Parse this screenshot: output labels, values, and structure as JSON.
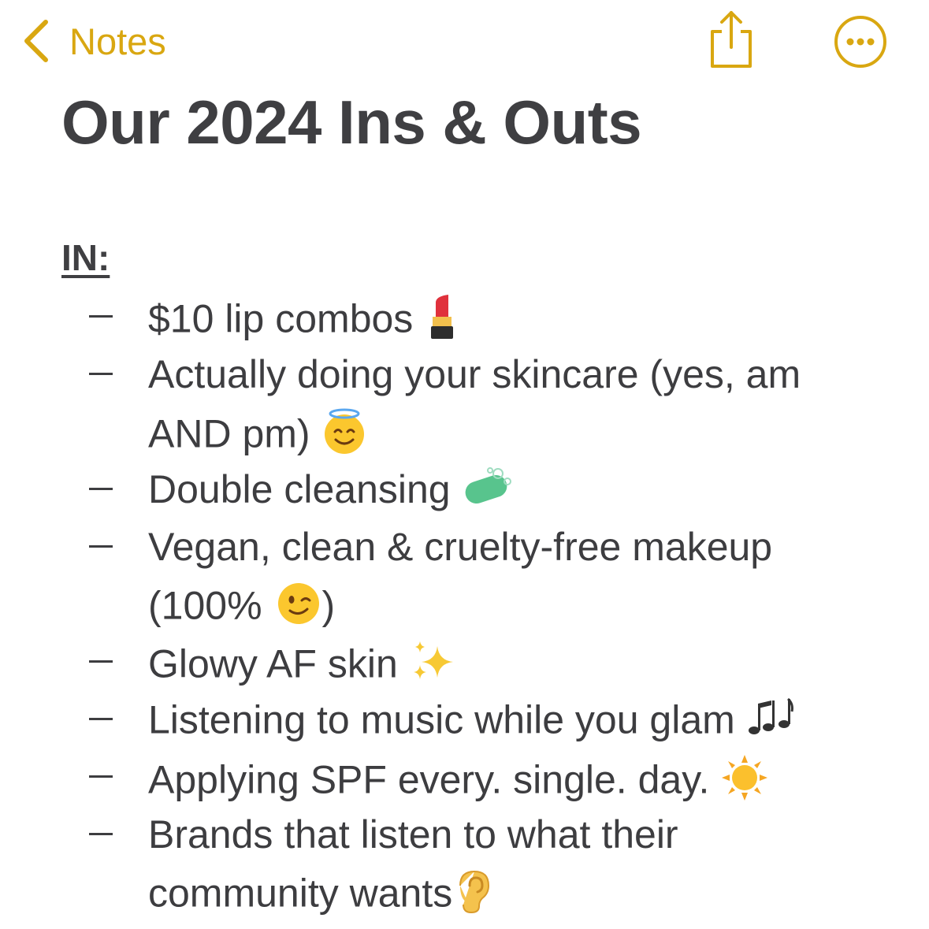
{
  "nav": {
    "back_label": "Notes",
    "accent": "#d9a711"
  },
  "note": {
    "title": "Our 2024 Ins & Outs",
    "section_heading": "IN:",
    "items": [
      {
        "lines": [
          "$10 lip combos"
        ],
        "emoji": "lipstick-icon"
      },
      {
        "lines": [
          "Actually doing your skincare (yes, am",
          "AND pm)"
        ],
        "emoji": "halo-smile-icon"
      },
      {
        "lines": [
          "Double cleansing"
        ],
        "emoji": "soap-icon"
      },
      {
        "lines": [
          "Vegan, clean & cruelty-free makeup",
          "(100% "
        ],
        "emoji": "wink-icon",
        "suffix": ")"
      },
      {
        "lines": [
          "Glowy AF skin"
        ],
        "emoji": "sparkles-icon"
      },
      {
        "lines": [
          "Listening to music while you glam"
        ],
        "emoji": "music-notes-icon"
      },
      {
        "lines": [
          "Applying SPF every. single. day."
        ],
        "emoji": "sun-icon"
      },
      {
        "lines": [
          "Brands that listen to what their",
          "community wants"
        ],
        "emoji": "ear-icon"
      }
    ]
  }
}
